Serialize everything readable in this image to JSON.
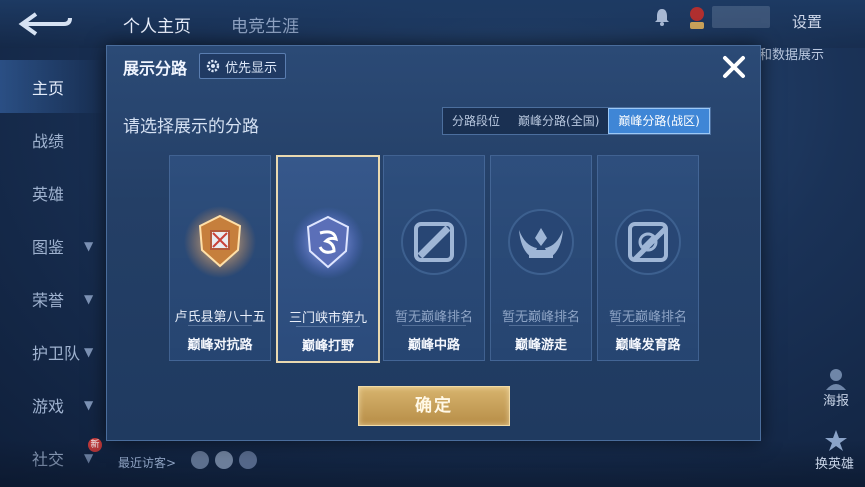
{
  "header": {
    "tabs": [
      "个人主页",
      "电竞生涯"
    ],
    "settings_label": "设置"
  },
  "sidebar": {
    "items": [
      {
        "label": "主页",
        "chevron": false
      },
      {
        "label": "战绩",
        "chevron": false
      },
      {
        "label": "英雄",
        "chevron": false
      },
      {
        "label": "图鉴",
        "chevron": true
      },
      {
        "label": "荣誉",
        "chevron": true
      },
      {
        "label": "护卫队",
        "chevron": true
      },
      {
        "label": "游戏",
        "chevron": true
      },
      {
        "label": "社交",
        "chevron": true
      }
    ],
    "new_badge": "新"
  },
  "recent_visitors_label": "最近访客>",
  "right_panel": {
    "partial_text": "和数据展示",
    "poster_label": "海报",
    "change_hero_label": "换英雄"
  },
  "modal": {
    "title": "展示分路",
    "priority_label": "优先显示",
    "subtitle": "请选择展示的分路",
    "segments": [
      "分路段位",
      "巅峰分路(全国)",
      "巅峰分路(战区)"
    ],
    "selected_segment": 2,
    "cards": [
      {
        "rank": "卢氏县第八十五",
        "lane": "巅峰对抗路",
        "emblem": "gold-shield-emblem",
        "active": true
      },
      {
        "rank": "三门峡市第九",
        "lane": "巅峰打野",
        "emblem": "blue-shield-emblem",
        "active": true
      },
      {
        "rank": "暂无巅峰排名",
        "lane": "巅峰中路",
        "emblem": "mid-lane-icon",
        "active": false
      },
      {
        "rank": "暂无巅峰排名",
        "lane": "巅峰游走",
        "emblem": "support-wings-icon",
        "active": false
      },
      {
        "rank": "暂无巅峰排名",
        "lane": "巅峰发育路",
        "emblem": "marksman-icon",
        "active": false
      }
    ],
    "selected_card": 1,
    "confirm_label": "确定"
  },
  "colors": {
    "accent_blue": "#3f86d6",
    "gold": "#c9a25a",
    "selected_border": "#e9d9b0"
  }
}
